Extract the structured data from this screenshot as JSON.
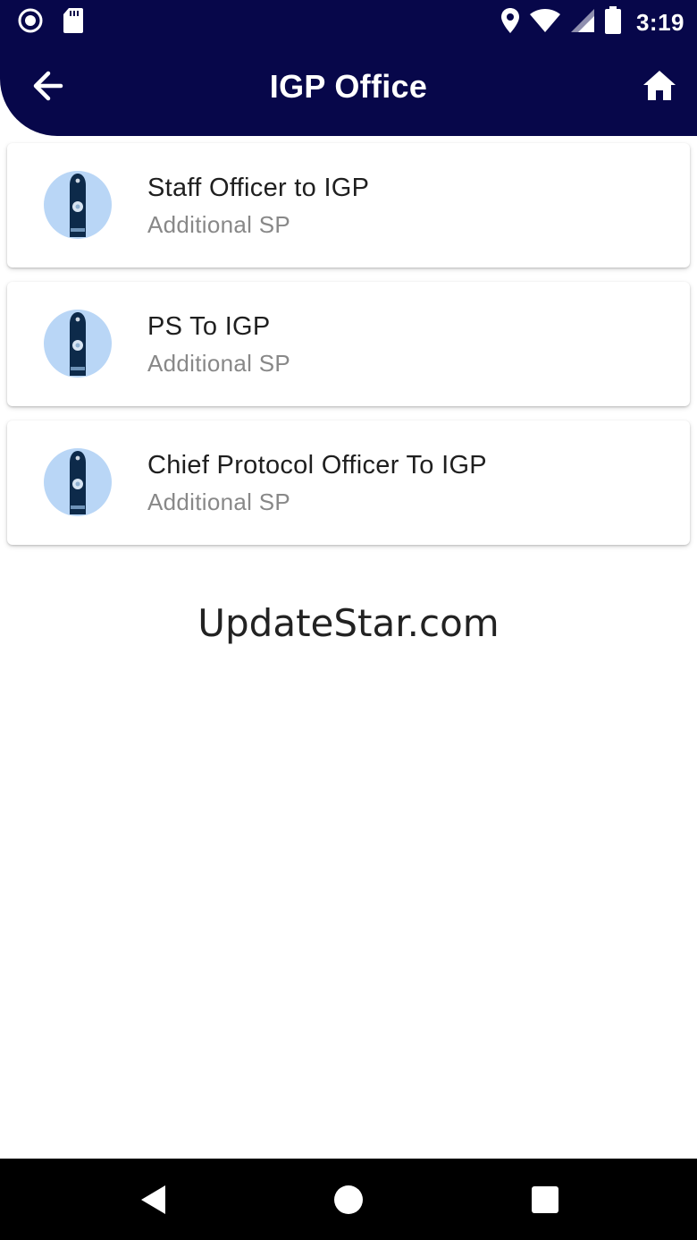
{
  "status_bar": {
    "time": "3:19",
    "icons": [
      "record-icon",
      "sd-card-icon",
      "location-icon",
      "wifi-icon",
      "signal-icon",
      "battery-icon"
    ]
  },
  "app_bar": {
    "title": "IGP Office",
    "back_icon": "arrow-left-icon",
    "home_icon": "home-icon",
    "color": "#07074a"
  },
  "items": [
    {
      "title": "Staff Officer to IGP",
      "subtitle": "Additional SP",
      "icon": "police-epaulette-icon"
    },
    {
      "title": "PS To IGP",
      "subtitle": "Additional SP",
      "icon": "police-epaulette-icon"
    },
    {
      "title": "Chief Protocol Officer To IGP",
      "subtitle": "Additional SP",
      "icon": "police-epaulette-icon"
    }
  ],
  "watermark": "UpdateStar.com",
  "nav_bar": {
    "icons": [
      "back-triangle-icon",
      "home-circle-icon",
      "recents-square-icon"
    ]
  }
}
